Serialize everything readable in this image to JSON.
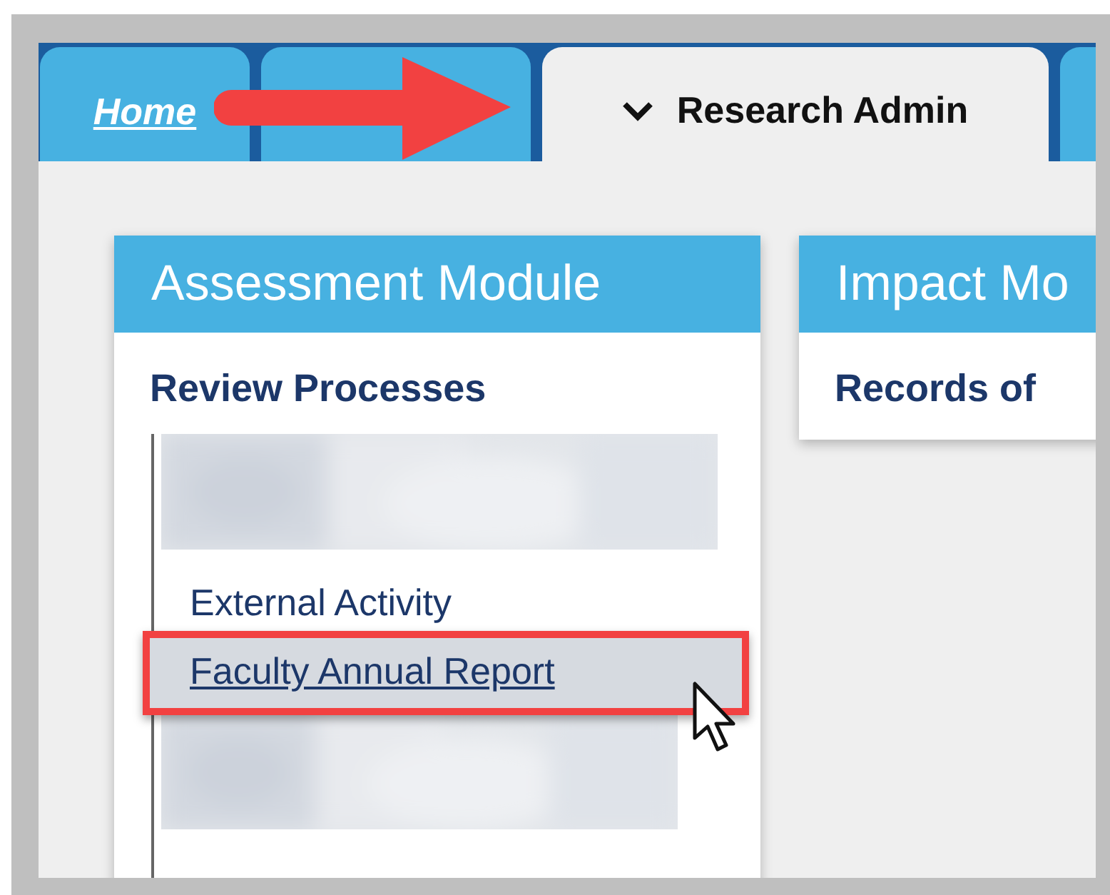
{
  "tabs": [
    {
      "label": "Home",
      "kind": "link",
      "selected": false
    },
    {
      "kind": "blank",
      "selected": false
    },
    {
      "label": "Research Admin",
      "kind": "menu",
      "selected": true
    },
    {
      "kind": "blank",
      "selected": false
    }
  ],
  "modules": [
    {
      "title": "Assessment Module",
      "section": "Review Processes",
      "items": [
        {
          "kind": "picture"
        },
        {
          "kind": "text",
          "label": "External Activity",
          "highlighted": false
        },
        {
          "kind": "link",
          "label": "Faculty Annual Report",
          "highlighted": true
        },
        {
          "kind": "picture"
        }
      ]
    },
    {
      "title": "Impact Mo",
      "section": "Records of"
    }
  ]
}
